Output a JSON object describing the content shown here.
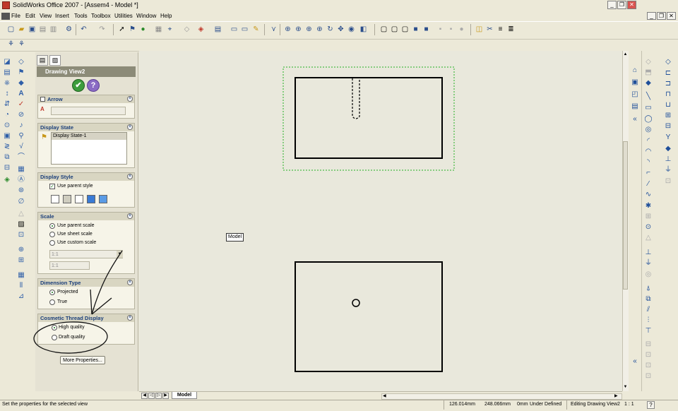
{
  "window": {
    "title": "SolidWorks Office 2007 - [Assem4 - Model *]",
    "controls": {
      "minimize": "_",
      "restore": "❐",
      "close": "✕"
    },
    "doc_controls": {
      "minimize": "_",
      "restore": "❐",
      "close": "✕"
    }
  },
  "menu": {
    "items": [
      "File",
      "Edit",
      "View",
      "Insert",
      "Tools",
      "Toolbox",
      "Utilities",
      "Window",
      "Help"
    ]
  },
  "property_manager": {
    "header": "Drawing View2",
    "ok_symbol": "✔",
    "help_symbol": "?",
    "arrow_group": {
      "title": "Arrow",
      "field_value": ""
    },
    "display_state": {
      "title": "Display State",
      "items": [
        "Display State-1"
      ]
    },
    "display_style": {
      "title": "Display Style",
      "use_parent_style": "Use parent style"
    },
    "scale": {
      "title": "Scale",
      "options": [
        "Use parent scale",
        "Use sheet scale",
        "Use custom scale"
      ],
      "selected": "Use parent scale",
      "custom_value": "1:1",
      "custom_value2": "1:1"
    },
    "dimension_type": {
      "title": "Dimension Type",
      "options": [
        "Projected",
        "True"
      ],
      "selected": "Projected"
    },
    "cosmetic_thread": {
      "title": "Cosmetic Thread Display",
      "options": [
        "High quality",
        "Draft quality"
      ],
      "selected": "High quality"
    },
    "more_properties": "More Properties..."
  },
  "canvas": {
    "tooltip": "Model",
    "sheet_tab": "Model"
  },
  "status": {
    "message": "Set the properties for the selected view",
    "x": "126.014mm",
    "y": "248.066mm",
    "z": "0mm",
    "state": "Under Defined",
    "mode": "Editing Drawing View2",
    "scale": "1 : 1"
  },
  "colors": {
    "canvas_bg": "#e9e8dc",
    "selection_box": "#22b022",
    "annotation_ink": "#111111",
    "pm_header": "#8c8b78"
  }
}
